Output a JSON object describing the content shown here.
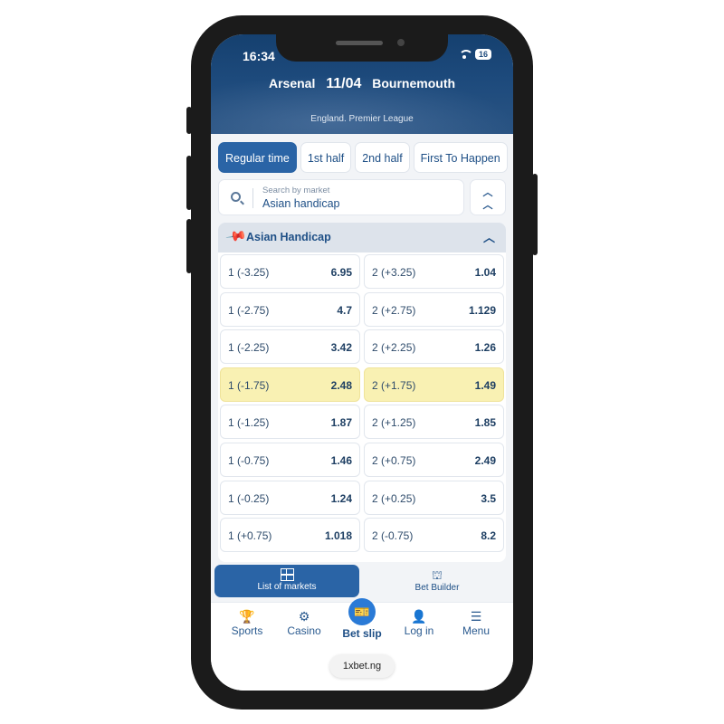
{
  "status_bar": {
    "time": "16:34",
    "battery": "16"
  },
  "match": {
    "home": "Arsenal",
    "date": "11/04",
    "away": "Bournemouth",
    "league": "England. Premier League"
  },
  "period_tabs": [
    {
      "label": "Regular time",
      "active": true
    },
    {
      "label": "1st half",
      "active": false
    },
    {
      "label": "2nd half",
      "active": false
    },
    {
      "label": "First To Happen",
      "active": false
    }
  ],
  "search": {
    "placeholder": "Search by market",
    "value": "Asian handicap"
  },
  "market": {
    "title": "Asian Handicap",
    "rows": [
      {
        "left_label": "1 (-3.25)",
        "left_odd": "6.95",
        "right_label": "2 (+3.25)",
        "right_odd": "1.04",
        "highlight": false
      },
      {
        "left_label": "1 (-2.75)",
        "left_odd": "4.7",
        "right_label": "2 (+2.75)",
        "right_odd": "1.129",
        "highlight": false
      },
      {
        "left_label": "1 (-2.25)",
        "left_odd": "3.42",
        "right_label": "2 (+2.25)",
        "right_odd": "1.26",
        "highlight": false
      },
      {
        "left_label": "1 (-1.75)",
        "left_odd": "2.48",
        "right_label": "2 (+1.75)",
        "right_odd": "1.49",
        "highlight": true
      },
      {
        "left_label": "1 (-1.25)",
        "left_odd": "1.87",
        "right_label": "2 (+1.25)",
        "right_odd": "1.85",
        "highlight": false
      },
      {
        "left_label": "1 (-0.75)",
        "left_odd": "1.46",
        "right_label": "2 (+0.75)",
        "right_odd": "2.49",
        "highlight": false
      },
      {
        "left_label": "1 (-0.25)",
        "left_odd": "1.24",
        "right_label": "2 (+0.25)",
        "right_odd": "3.5",
        "highlight": false
      },
      {
        "left_label": "1 (+0.75)",
        "left_odd": "1.018",
        "right_label": "2 (-0.75)",
        "right_odd": "8.2",
        "highlight": false
      }
    ]
  },
  "bottom_tabs": {
    "list_of_markets": "List of markets",
    "bet_builder": "Bet Builder"
  },
  "nav": {
    "sports": "Sports",
    "casino": "Casino",
    "bet_slip": "Bet slip",
    "log_in": "Log in",
    "menu": "Menu"
  },
  "url": "1xbet.ng",
  "colors": {
    "primary": "#2a64a6",
    "header": "#1d4a7c",
    "highlight": "#f9f1b3",
    "text": "#1e4f86"
  }
}
